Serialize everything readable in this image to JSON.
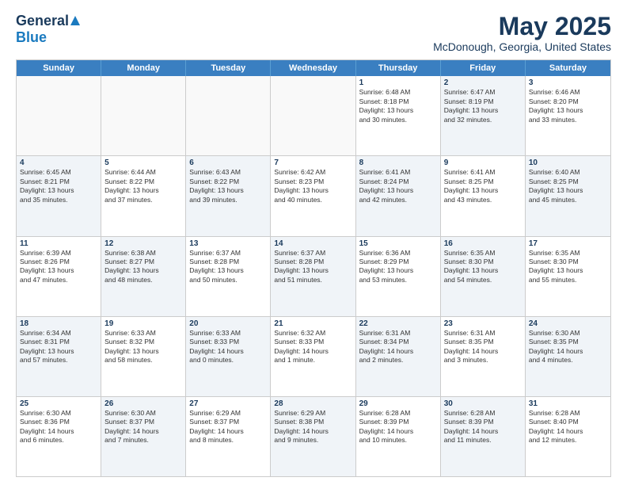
{
  "logo": {
    "general": "General",
    "blue": "Blue"
  },
  "title": {
    "month": "May 2025",
    "location": "McDonough, Georgia, United States"
  },
  "weekdays": [
    "Sunday",
    "Monday",
    "Tuesday",
    "Wednesday",
    "Thursday",
    "Friday",
    "Saturday"
  ],
  "rows": [
    [
      {
        "day": "",
        "info": "",
        "shaded": false,
        "empty": true
      },
      {
        "day": "",
        "info": "",
        "shaded": false,
        "empty": true
      },
      {
        "day": "",
        "info": "",
        "shaded": false,
        "empty": true
      },
      {
        "day": "",
        "info": "",
        "shaded": false,
        "empty": true
      },
      {
        "day": "1",
        "info": "Sunrise: 6:48 AM\nSunset: 8:18 PM\nDaylight: 13 hours\nand 30 minutes.",
        "shaded": false,
        "empty": false
      },
      {
        "day": "2",
        "info": "Sunrise: 6:47 AM\nSunset: 8:19 PM\nDaylight: 13 hours\nand 32 minutes.",
        "shaded": true,
        "empty": false
      },
      {
        "day": "3",
        "info": "Sunrise: 6:46 AM\nSunset: 8:20 PM\nDaylight: 13 hours\nand 33 minutes.",
        "shaded": false,
        "empty": false
      }
    ],
    [
      {
        "day": "4",
        "info": "Sunrise: 6:45 AM\nSunset: 8:21 PM\nDaylight: 13 hours\nand 35 minutes.",
        "shaded": true,
        "empty": false
      },
      {
        "day": "5",
        "info": "Sunrise: 6:44 AM\nSunset: 8:22 PM\nDaylight: 13 hours\nand 37 minutes.",
        "shaded": false,
        "empty": false
      },
      {
        "day": "6",
        "info": "Sunrise: 6:43 AM\nSunset: 8:22 PM\nDaylight: 13 hours\nand 39 minutes.",
        "shaded": true,
        "empty": false
      },
      {
        "day": "7",
        "info": "Sunrise: 6:42 AM\nSunset: 8:23 PM\nDaylight: 13 hours\nand 40 minutes.",
        "shaded": false,
        "empty": false
      },
      {
        "day": "8",
        "info": "Sunrise: 6:41 AM\nSunset: 8:24 PM\nDaylight: 13 hours\nand 42 minutes.",
        "shaded": true,
        "empty": false
      },
      {
        "day": "9",
        "info": "Sunrise: 6:41 AM\nSunset: 8:25 PM\nDaylight: 13 hours\nand 43 minutes.",
        "shaded": false,
        "empty": false
      },
      {
        "day": "10",
        "info": "Sunrise: 6:40 AM\nSunset: 8:25 PM\nDaylight: 13 hours\nand 45 minutes.",
        "shaded": true,
        "empty": false
      }
    ],
    [
      {
        "day": "11",
        "info": "Sunrise: 6:39 AM\nSunset: 8:26 PM\nDaylight: 13 hours\nand 47 minutes.",
        "shaded": false,
        "empty": false
      },
      {
        "day": "12",
        "info": "Sunrise: 6:38 AM\nSunset: 8:27 PM\nDaylight: 13 hours\nand 48 minutes.",
        "shaded": true,
        "empty": false
      },
      {
        "day": "13",
        "info": "Sunrise: 6:37 AM\nSunset: 8:28 PM\nDaylight: 13 hours\nand 50 minutes.",
        "shaded": false,
        "empty": false
      },
      {
        "day": "14",
        "info": "Sunrise: 6:37 AM\nSunset: 8:28 PM\nDaylight: 13 hours\nand 51 minutes.",
        "shaded": true,
        "empty": false
      },
      {
        "day": "15",
        "info": "Sunrise: 6:36 AM\nSunset: 8:29 PM\nDaylight: 13 hours\nand 53 minutes.",
        "shaded": false,
        "empty": false
      },
      {
        "day": "16",
        "info": "Sunrise: 6:35 AM\nSunset: 8:30 PM\nDaylight: 13 hours\nand 54 minutes.",
        "shaded": true,
        "empty": false
      },
      {
        "day": "17",
        "info": "Sunrise: 6:35 AM\nSunset: 8:30 PM\nDaylight: 13 hours\nand 55 minutes.",
        "shaded": false,
        "empty": false
      }
    ],
    [
      {
        "day": "18",
        "info": "Sunrise: 6:34 AM\nSunset: 8:31 PM\nDaylight: 13 hours\nand 57 minutes.",
        "shaded": true,
        "empty": false
      },
      {
        "day": "19",
        "info": "Sunrise: 6:33 AM\nSunset: 8:32 PM\nDaylight: 13 hours\nand 58 minutes.",
        "shaded": false,
        "empty": false
      },
      {
        "day": "20",
        "info": "Sunrise: 6:33 AM\nSunset: 8:33 PM\nDaylight: 14 hours\nand 0 minutes.",
        "shaded": true,
        "empty": false
      },
      {
        "day": "21",
        "info": "Sunrise: 6:32 AM\nSunset: 8:33 PM\nDaylight: 14 hours\nand 1 minute.",
        "shaded": false,
        "empty": false
      },
      {
        "day": "22",
        "info": "Sunrise: 6:31 AM\nSunset: 8:34 PM\nDaylight: 14 hours\nand 2 minutes.",
        "shaded": true,
        "empty": false
      },
      {
        "day": "23",
        "info": "Sunrise: 6:31 AM\nSunset: 8:35 PM\nDaylight: 14 hours\nand 3 minutes.",
        "shaded": false,
        "empty": false
      },
      {
        "day": "24",
        "info": "Sunrise: 6:30 AM\nSunset: 8:35 PM\nDaylight: 14 hours\nand 4 minutes.",
        "shaded": true,
        "empty": false
      }
    ],
    [
      {
        "day": "25",
        "info": "Sunrise: 6:30 AM\nSunset: 8:36 PM\nDaylight: 14 hours\nand 6 minutes.",
        "shaded": false,
        "empty": false
      },
      {
        "day": "26",
        "info": "Sunrise: 6:30 AM\nSunset: 8:37 PM\nDaylight: 14 hours\nand 7 minutes.",
        "shaded": true,
        "empty": false
      },
      {
        "day": "27",
        "info": "Sunrise: 6:29 AM\nSunset: 8:37 PM\nDaylight: 14 hours\nand 8 minutes.",
        "shaded": false,
        "empty": false
      },
      {
        "day": "28",
        "info": "Sunrise: 6:29 AM\nSunset: 8:38 PM\nDaylight: 14 hours\nand 9 minutes.",
        "shaded": true,
        "empty": false
      },
      {
        "day": "29",
        "info": "Sunrise: 6:28 AM\nSunset: 8:39 PM\nDaylight: 14 hours\nand 10 minutes.",
        "shaded": false,
        "empty": false
      },
      {
        "day": "30",
        "info": "Sunrise: 6:28 AM\nSunset: 8:39 PM\nDaylight: 14 hours\nand 11 minutes.",
        "shaded": true,
        "empty": false
      },
      {
        "day": "31",
        "info": "Sunrise: 6:28 AM\nSunset: 8:40 PM\nDaylight: 14 hours\nand 12 minutes.",
        "shaded": false,
        "empty": false
      }
    ]
  ]
}
